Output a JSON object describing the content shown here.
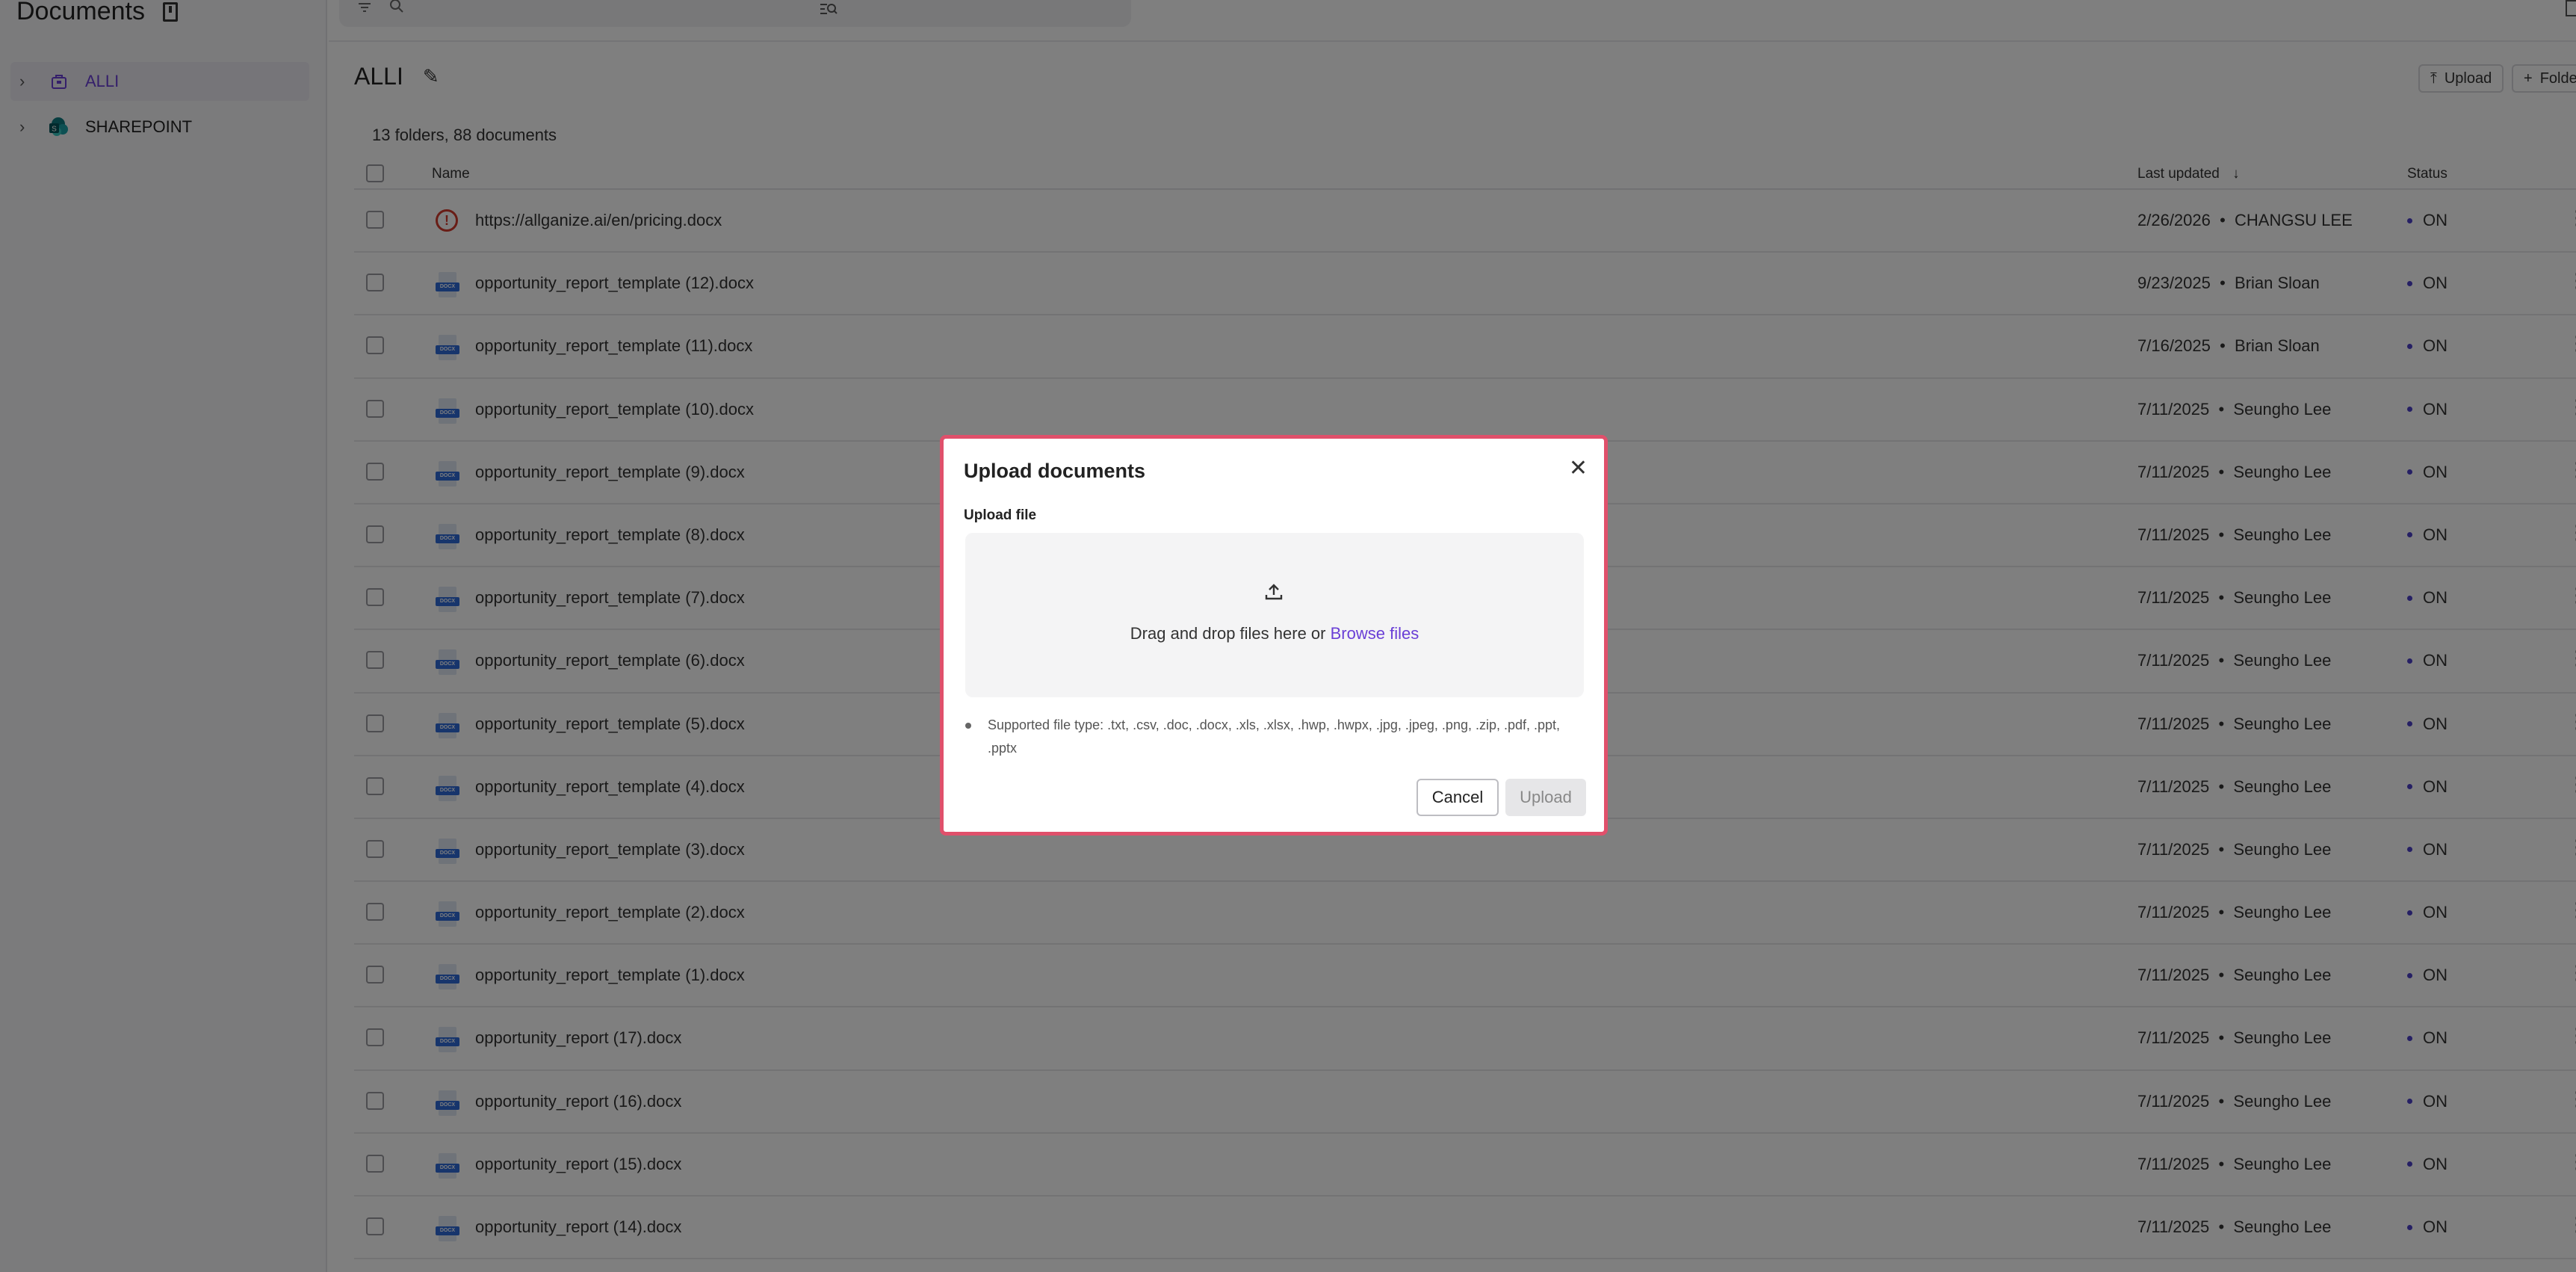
{
  "app": {
    "title": "Documents"
  },
  "sidebar": {
    "items": [
      {
        "label": "ALLI",
        "active": true
      },
      {
        "label": "SHAREPOINT",
        "active": false
      }
    ]
  },
  "main": {
    "folder_title": "ALLI",
    "upload_label": "Upload",
    "folder_label": "Folder",
    "count": "13 folders, 88 documents",
    "columns": {
      "name": "Name",
      "last_updated": "Last updated",
      "status": "Status"
    },
    "rows": [
      {
        "name": "https://allganize.ai/en/pricing.docx",
        "date": "2/26/2026",
        "user": "CHANGSU LEE",
        "status": "ON",
        "icon": "error"
      },
      {
        "name": "opportunity_report_template (12).docx",
        "date": "9/23/2025",
        "user": "Brian Sloan",
        "status": "ON",
        "icon": "docx"
      },
      {
        "name": "opportunity_report_template (11).docx",
        "date": "7/16/2025",
        "user": "Brian Sloan",
        "status": "ON",
        "icon": "docx"
      },
      {
        "name": "opportunity_report_template (10).docx",
        "date": "7/11/2025",
        "user": "Seungho Lee",
        "status": "ON",
        "icon": "docx"
      },
      {
        "name": "opportunity_report_template (9).docx",
        "date": "7/11/2025",
        "user": "Seungho Lee",
        "status": "ON",
        "icon": "docx"
      },
      {
        "name": "opportunity_report_template (8).docx",
        "date": "7/11/2025",
        "user": "Seungho Lee",
        "status": "ON",
        "icon": "docx"
      },
      {
        "name": "opportunity_report_template (7).docx",
        "date": "7/11/2025",
        "user": "Seungho Lee",
        "status": "ON",
        "icon": "docx"
      },
      {
        "name": "opportunity_report_template (6).docx",
        "date": "7/11/2025",
        "user": "Seungho Lee",
        "status": "ON",
        "icon": "docx"
      },
      {
        "name": "opportunity_report_template (5).docx",
        "date": "7/11/2025",
        "user": "Seungho Lee",
        "status": "ON",
        "icon": "docx"
      },
      {
        "name": "opportunity_report_template (4).docx",
        "date": "7/11/2025",
        "user": "Seungho Lee",
        "status": "ON",
        "icon": "docx"
      },
      {
        "name": "opportunity_report_template (3).docx",
        "date": "7/11/2025",
        "user": "Seungho Lee",
        "status": "ON",
        "icon": "docx"
      },
      {
        "name": "opportunity_report_template (2).docx",
        "date": "7/11/2025",
        "user": "Seungho Lee",
        "status": "ON",
        "icon": "docx"
      },
      {
        "name": "opportunity_report_template (1).docx",
        "date": "7/11/2025",
        "user": "Seungho Lee",
        "status": "ON",
        "icon": "docx"
      },
      {
        "name": "opportunity_report (17).docx",
        "date": "7/11/2025",
        "user": "Seungho Lee",
        "status": "ON",
        "icon": "docx"
      },
      {
        "name": "opportunity_report (16).docx",
        "date": "7/11/2025",
        "user": "Seungho Lee",
        "status": "ON",
        "icon": "docx"
      },
      {
        "name": "opportunity_report (15).docx",
        "date": "7/11/2025",
        "user": "Seungho Lee",
        "status": "ON",
        "icon": "docx"
      },
      {
        "name": "opportunity_report (14).docx",
        "date": "7/11/2025",
        "user": "Seungho Lee",
        "status": "ON",
        "icon": "docx"
      }
    ]
  },
  "modal": {
    "title": "Upload documents",
    "section_label": "Upload file",
    "drop_text": "Drag and drop files here or",
    "browse_label": "Browse files",
    "supported_types": "Supported file type: .txt, .csv, .doc, .docx, .xls, .xlsx, .hwp, .hwpx, .jpg, .jpeg, .png, .zip, .pdf, .ppt, .pptx",
    "cancel_label": "Cancel",
    "upload_label": "Upload"
  },
  "colors": {
    "accent": "#6a3fd6",
    "modal_border": "#e0506b",
    "status_dot": "#4a3fc9",
    "error": "#d23b2d"
  }
}
